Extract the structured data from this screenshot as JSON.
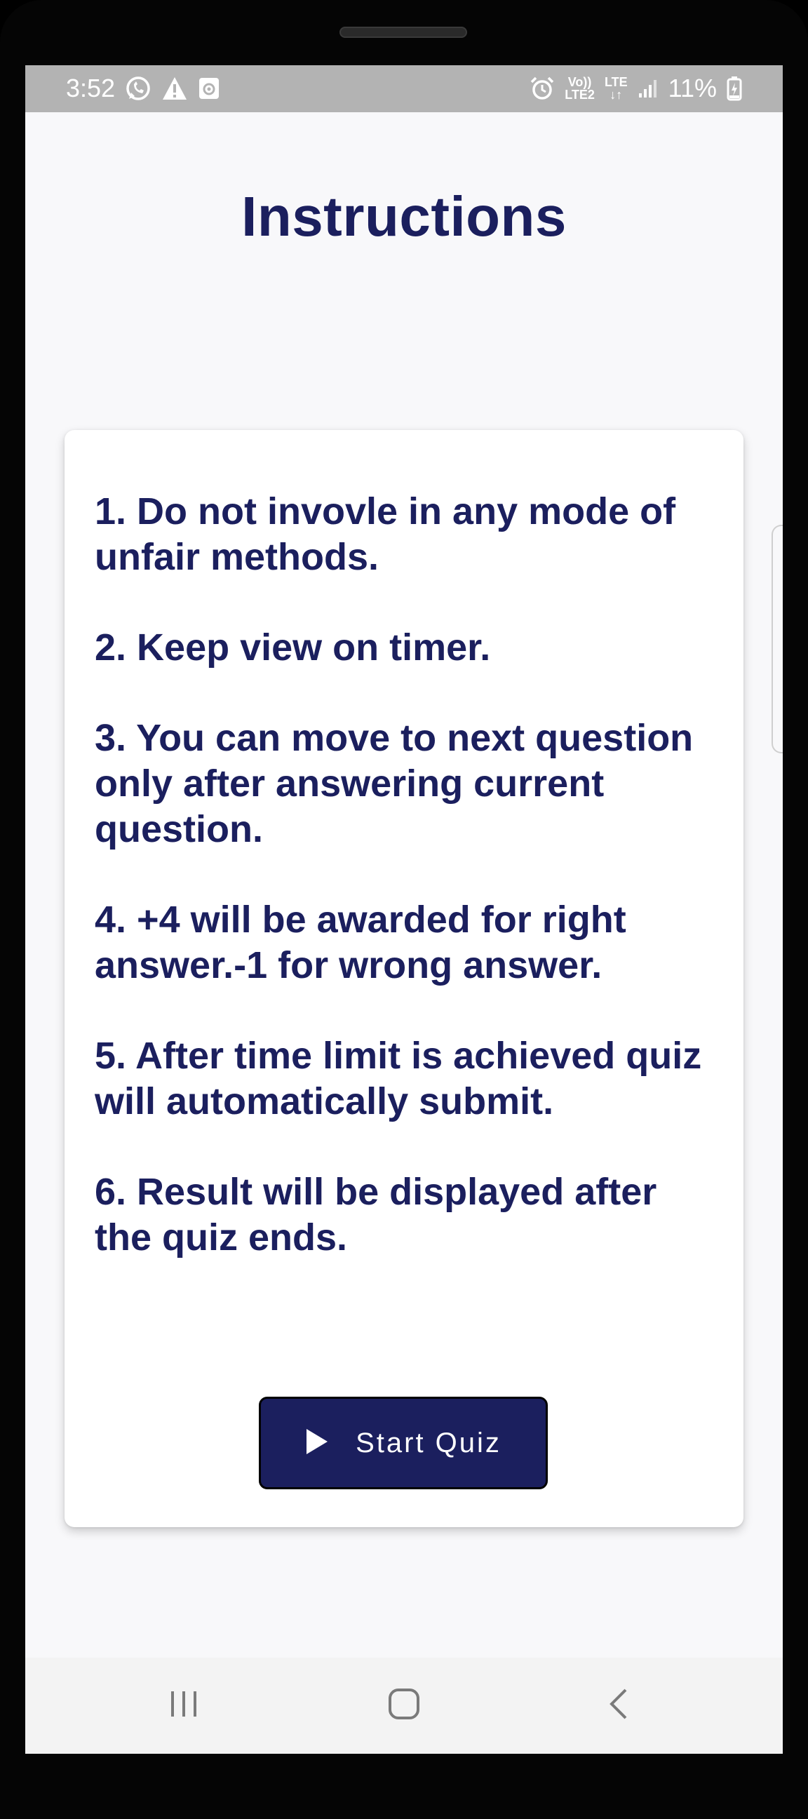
{
  "status_bar": {
    "time": "3:52",
    "battery_percent": "11%",
    "network_volte": "Vo))",
    "network_lte2": "LTE2",
    "network_lte": "LTE",
    "background_color": "#b3b3b3"
  },
  "page": {
    "title": "Instructions",
    "title_color": "#1b1f5e"
  },
  "instructions": [
    "1. Do not invovle in any mode of unfair methods.",
    "2. Keep view on timer.",
    "3. You can move to next question only after answering current question.",
    "4. +4 will be awarded for right answer.-1 for wrong answer.",
    "5. After time limit is achieved quiz will automatically submit.",
    "6. Result will be displayed after the quiz ends."
  ],
  "start_button": {
    "label": "Start Quiz",
    "icon": "play-icon",
    "color": "#1b1f5e"
  },
  "nav_bar": {
    "recents_icon": "recents-icon",
    "home_icon": "home-icon",
    "back_icon": "back-icon"
  }
}
